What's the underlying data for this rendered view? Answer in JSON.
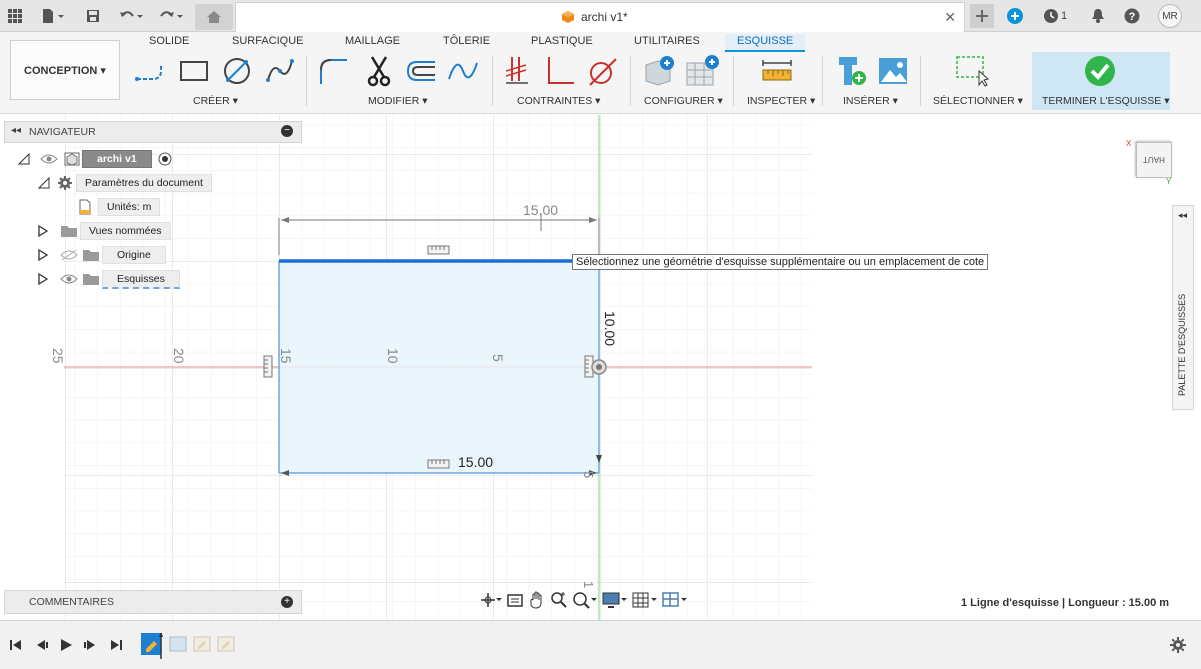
{
  "app": {
    "document_title": "archi v1*",
    "user_initials": "MR",
    "jobs_count": "1"
  },
  "ribbon": {
    "workspace": "CONCEPTION ▾",
    "tabs": [
      "SOLIDE",
      "SURFACIQUE",
      "MAILLAGE",
      "TÔLERIE",
      "PLASTIQUE",
      "UTILITAIRES",
      "ESQUISSE"
    ],
    "groups": {
      "create": "CRÉER ▾",
      "modify": "MODIFIER ▾",
      "constraints": "CONTRAINTES ▾",
      "configure": "CONFIGURER ▾",
      "inspect": "INSPECTER ▾",
      "insert": "INSÉRER ▾",
      "select": "SÉLECTIONNER ▾",
      "finish": "TERMINER L'ESQUISSE ▾"
    }
  },
  "navigator": {
    "title": "NAVIGATEUR",
    "root": "archi v1",
    "doc_params": "Paramètres du document",
    "units": "Unités: m",
    "named_views": "Vues nommées",
    "origin": "Origine",
    "sketches": "Esquisses"
  },
  "comments": {
    "title": "COMMENTAIRES"
  },
  "sketch": {
    "tooltip": "Sélectionnez une géométrie d'esquisse supplémentaire ou un emplacement de cote",
    "dim_top": "15.00",
    "dim_bottom": "15.00",
    "dim_right": "10.00",
    "axis_labels": [
      "25",
      "20",
      "15",
      "10",
      "5"
    ],
    "axis_label_right": "5",
    "axis_label_bottom": "1"
  },
  "viewcube": {
    "face": "HAUT",
    "axis_x": "X",
    "axis_y": "Y"
  },
  "palette": {
    "label": "PALETTE D'ESQUISSES"
  },
  "status": {
    "text": "1 Ligne d'esquisse | Longueur : 15.00 m"
  },
  "colors": {
    "accent": "#0696d7",
    "selected_line": "#1c6fd8",
    "sketch_fill": "#e8f3fb",
    "axis_red": "#e58a8a",
    "axis_green": "#7fd47f",
    "finish_green": "#2fb54a"
  }
}
